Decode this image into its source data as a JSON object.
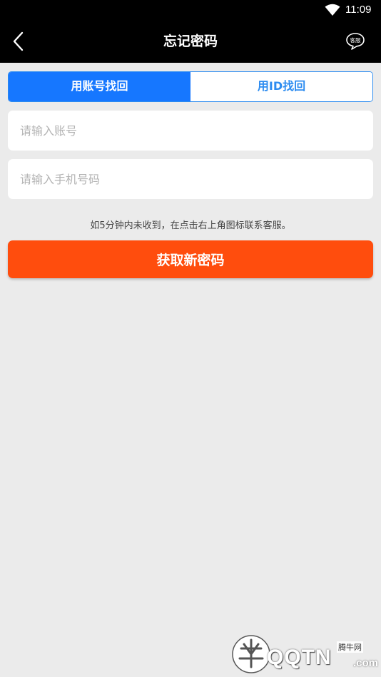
{
  "status_bar": {
    "time": "11:09"
  },
  "header": {
    "title": "忘记密码",
    "cs_label": "客服"
  },
  "tabs": [
    {
      "label": "用账号找回",
      "active": true
    },
    {
      "label": "用ID找回",
      "active": false
    }
  ],
  "form": {
    "account": {
      "placeholder": "请输入账号",
      "value": ""
    },
    "phone": {
      "placeholder": "请输入手机号码",
      "value": ""
    }
  },
  "hint": "如5分钟内未收到，在点击右上角图标联系客服。",
  "submit_label": "获取新密码",
  "watermark": {
    "site": "腾牛网",
    "brand": "QQTN",
    "domain": ".com"
  },
  "colors": {
    "tab_active": "#1677ff",
    "tab_border": "#2d8cf0",
    "submit": "#ff4d0d",
    "background": "#ebebeb"
  }
}
